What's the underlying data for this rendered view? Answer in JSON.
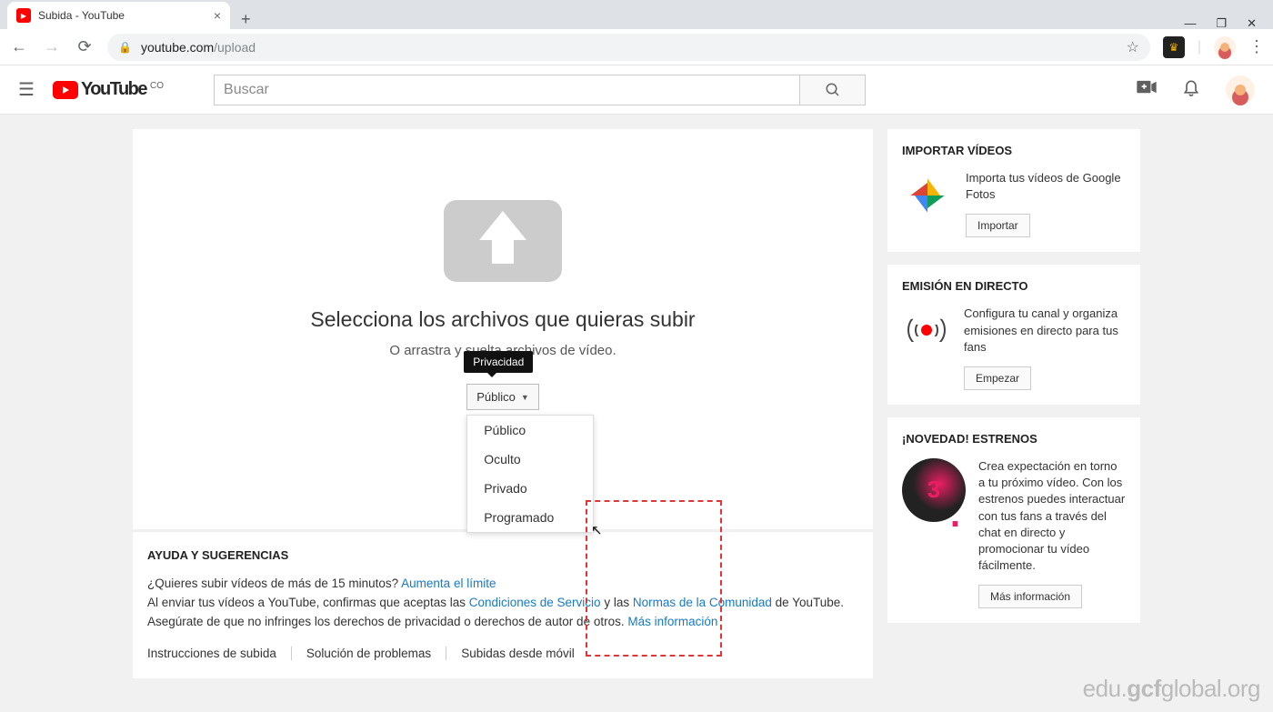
{
  "browser": {
    "tab_title": "Subida - YouTube",
    "url_domain": "youtube.com",
    "url_path": "/upload"
  },
  "header": {
    "logo_text": "YouTube",
    "logo_region": "CO",
    "search_placeholder": "Buscar"
  },
  "upload": {
    "title": "Selecciona los archivos que quieras subir",
    "subtitle": "O arrastra y suelta archivos de vídeo.",
    "tooltip": "Privacidad",
    "selected": "Público",
    "options": [
      "Público",
      "Oculto",
      "Privado",
      "Programado"
    ]
  },
  "help": {
    "title": "AYUDA Y SUGERENCIAS",
    "line1_pre": "¿Quieres subir vídeos de más de 15 minutos? ",
    "line1_link": "Aumenta el límite",
    "line2_pre": "Al enviar tus vídeos a YouTube, confirmas que aceptas las ",
    "line2_link1": "Condiciones de Servicio",
    "line2_mid": " y las ",
    "line2_link2": "Normas de la Comunidad",
    "line2_post": " de YouTube.",
    "line3_pre": "Asegúrate de que no infringes los derechos de privacidad o derechos de autor de otros. ",
    "line3_link": "Más información",
    "links": [
      "Instrucciones de subida",
      "Solución de problemas",
      "Subidas desde móvil"
    ]
  },
  "sidebar": {
    "import": {
      "title": "IMPORTAR VÍDEOS",
      "text": "Importa tus vídeos de Google Fotos",
      "button": "Importar"
    },
    "live": {
      "title": "EMISIÓN EN DIRECTO",
      "text": "Configura tu canal y organiza emisiones en directo para tus fans",
      "button": "Empezar"
    },
    "premiere": {
      "title": "¡NOVEDAD! ESTRENOS",
      "text": "Crea expectación en torno a tu próximo vídeo. Con los estrenos puedes interactuar con tus fans a través del chat en directo y promocionar tu vídeo fácilmente.",
      "button": "Más información",
      "icon_number": "3"
    }
  },
  "watermark": {
    "w1": "edu.",
    "w2": "gcf",
    "w3": "global",
    "w4": ".org"
  }
}
